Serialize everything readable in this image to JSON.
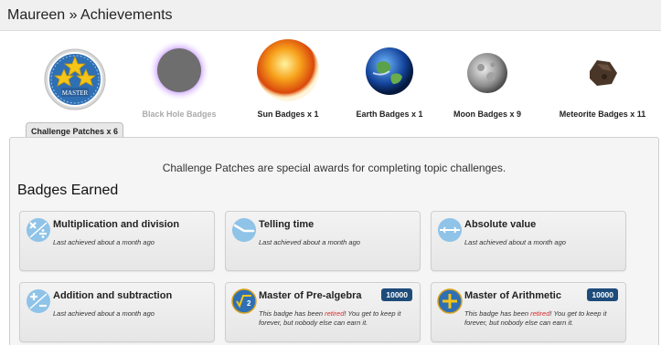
{
  "header": {
    "title": "Maureen » Achievements"
  },
  "badge_categories": [
    {
      "label": "Challenge Patches x 6",
      "selected": true,
      "icon": "master-patch-icon",
      "patch_text": "MASTER"
    },
    {
      "label": "Black Hole Badges",
      "dim": true,
      "icon": "black-hole-icon"
    },
    {
      "label": "Sun Badges x 1",
      "icon": "sun-icon"
    },
    {
      "label": "Earth Badges x 1",
      "icon": "earth-icon"
    },
    {
      "label": "Moon Badges x 9",
      "icon": "moon-icon"
    },
    {
      "label": "Meteorite Badges x 11",
      "icon": "meteorite-icon"
    }
  ],
  "panel": {
    "description": "Challenge Patches are special awards for completing topic challenges.",
    "title": "Badges Earned"
  },
  "badges": [
    {
      "title": "Multiplication and division",
      "desc": "Last achieved about a month ago",
      "icon": "multiply-divide-icon"
    },
    {
      "title": "Telling time",
      "desc": "Last achieved about a month ago",
      "icon": "clock-icon"
    },
    {
      "title": "Absolute value",
      "desc": "Last achieved about a month ago",
      "icon": "absolute-value-icon"
    },
    {
      "title": "Addition and subtraction",
      "desc": "Last achieved about a month ago",
      "icon": "plus-minus-icon"
    },
    {
      "title": "Master of Pre-algebra",
      "points": "10000",
      "desc_pre": "This badge has been ",
      "desc_red": "retired",
      "desc_post": "! You get to keep it forever, but nobody else can earn it.",
      "icon": "sqrt-master-icon"
    },
    {
      "title": "Master of Arithmetic",
      "points": "10000",
      "desc_pre": "This badge has been ",
      "desc_red": "retired",
      "desc_post": "! You get to keep it forever, but nobody else can earn it.",
      "icon": "plus-master-icon"
    }
  ],
  "colors": {
    "accent": "#1e4c7a",
    "retired": "#d9292b",
    "icon_blue": "#8fc3e8"
  }
}
